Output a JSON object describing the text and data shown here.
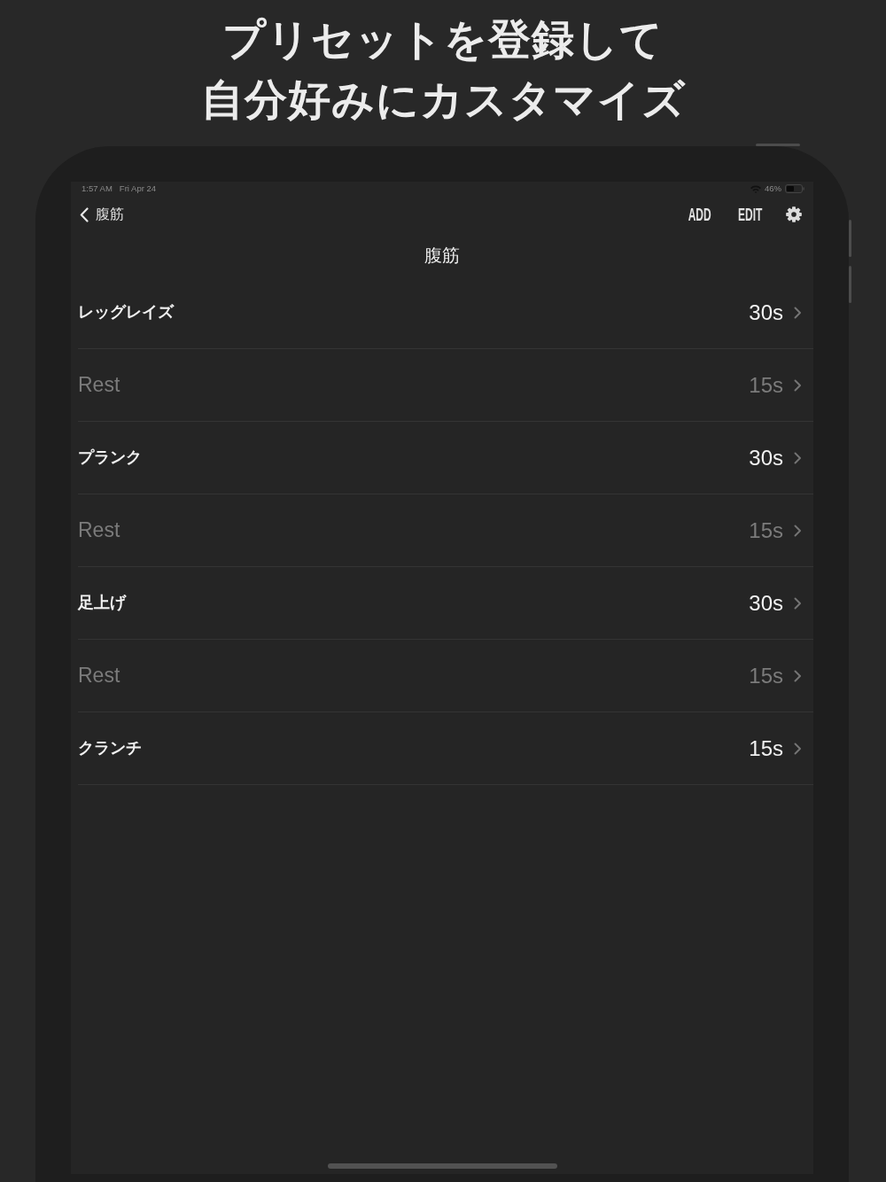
{
  "headline": [
    "プリセットを登録して",
    "自分好みにカスタマイズ"
  ],
  "status_bar": {
    "time": "1:57 AM",
    "date": "Fri Apr 24",
    "battery_percent": "46%"
  },
  "nav": {
    "back_label": "腹筋",
    "actions": [
      "ADD",
      "EDIT"
    ],
    "title": "腹筋"
  },
  "rows": [
    {
      "kind": "exercise",
      "name": "レッグレイズ",
      "duration": "30s"
    },
    {
      "kind": "rest",
      "name": "Rest",
      "duration": "15s"
    },
    {
      "kind": "exercise",
      "name": "プランク",
      "duration": "30s"
    },
    {
      "kind": "rest",
      "name": "Rest",
      "duration": "15s"
    },
    {
      "kind": "exercise",
      "name": "足上げ",
      "duration": "30s"
    },
    {
      "kind": "rest",
      "name": "Rest",
      "duration": "15s"
    },
    {
      "kind": "exercise",
      "name": "クランチ",
      "duration": "15s"
    }
  ]
}
